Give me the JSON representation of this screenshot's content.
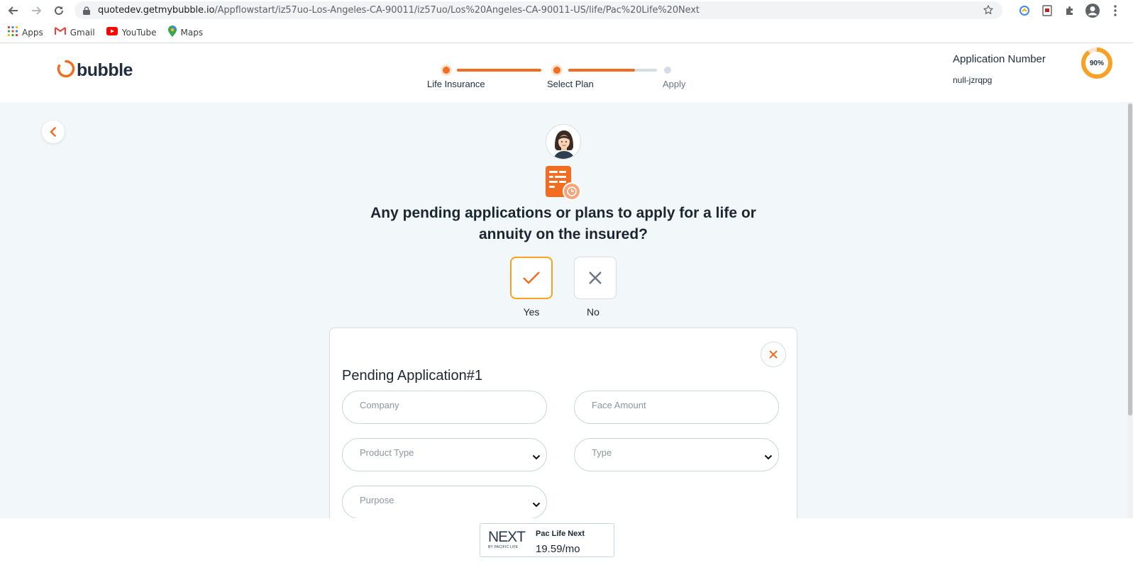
{
  "browser": {
    "url_host": "quotedev.getmybubble.io",
    "url_path": "/Appflowstart/iz57uo-Los-Angeles-CA-90011/iz57uo/Los%20Angeles-CA-90011-US/life/Pac%20Life%20Next",
    "bookmarks": [
      {
        "label": "Apps",
        "icon": "apps-grid-icon"
      },
      {
        "label": "Gmail",
        "icon": "gmail-icon"
      },
      {
        "label": "YouTube",
        "icon": "youtube-icon"
      },
      {
        "label": "Maps",
        "icon": "maps-icon"
      }
    ]
  },
  "header": {
    "logo_text": "bubble",
    "steps": [
      {
        "label": "Life Insurance",
        "state": "done"
      },
      {
        "label": "Select Plan",
        "state": "current"
      },
      {
        "label": "Apply",
        "state": "upcoming"
      }
    ],
    "application_number_label": "Application Number",
    "application_number_value": "null-jzrqpg",
    "progress_label": "90%",
    "progress_value": 0.9
  },
  "question": {
    "text": "Any pending applications or plans to apply for a life or annuity on the insured?",
    "yes_label": "Yes",
    "no_label": "No",
    "selected": "Yes"
  },
  "pending_card": {
    "title": "Pending Application#1",
    "fields": {
      "company": "Company",
      "face_amount": "Face Amount",
      "product_type": "Product Type",
      "type": "Type",
      "purpose": "Purpose"
    }
  },
  "plan": {
    "logo_main": "NEXT",
    "logo_sub": "BY PACIFIC LIFE",
    "name": "Pac Life Next",
    "price": "19.59/mo"
  },
  "colors": {
    "accent": "#f26d21",
    "yes_border": "#f7a226",
    "background": "#f2f7f9"
  }
}
